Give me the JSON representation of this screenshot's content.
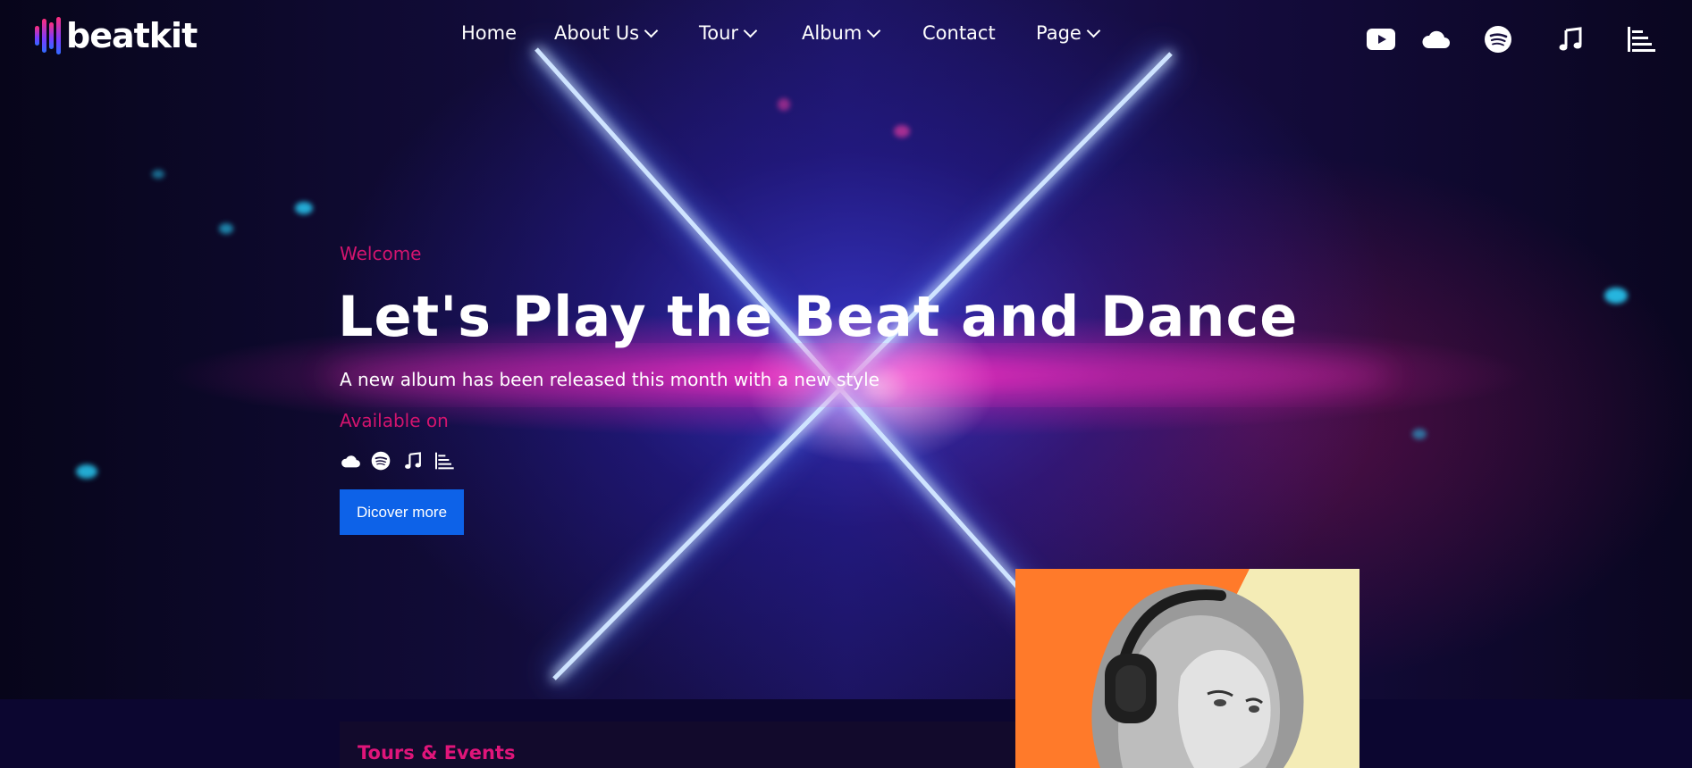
{
  "brand": {
    "name": "beatkit"
  },
  "nav": [
    {
      "label": "Home",
      "has_dropdown": false
    },
    {
      "label": "About Us",
      "has_dropdown": true
    },
    {
      "label": "Tour",
      "has_dropdown": true
    },
    {
      "label": "Album",
      "has_dropdown": true
    },
    {
      "label": "Contact",
      "has_dropdown": false
    },
    {
      "label": "Page",
      "has_dropdown": true
    }
  ],
  "social_icons": [
    "youtube-icon",
    "soundcloud-icon",
    "spotify-icon",
    "music-note-icon",
    "deezer-icon"
  ],
  "hero": {
    "eyebrow": "Welcome",
    "title": "Let's Play the Beat and Dance",
    "subtitle": "A new album has been released this month with a new style",
    "available_label": "Available on",
    "platform_icons": [
      "soundcloud-icon",
      "spotify-icon",
      "music-note-icon",
      "deezer-icon"
    ],
    "cta_label": "Dicover more"
  },
  "events": {
    "title": "Tours & Events"
  },
  "colors": {
    "accent": "#d4146e",
    "button": "#0d62e8",
    "section_bg": "#0c0630"
  }
}
